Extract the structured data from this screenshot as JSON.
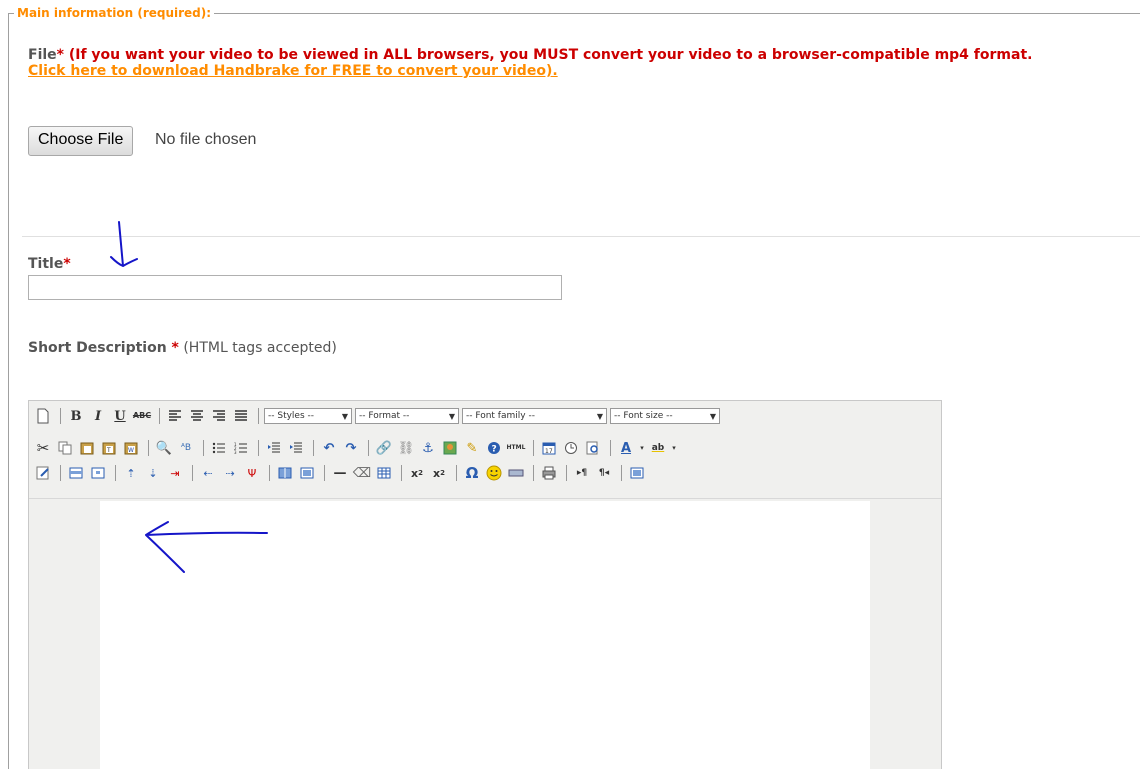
{
  "section": {
    "legend": "Main information (required):"
  },
  "file": {
    "label": "File",
    "required_mark": "*",
    "warning": " (If you want your video to be viewed in ALL browsers, you MUST convert your video to a browser-compatible mp4 format.",
    "link": "Click here to download Handbrake for FREE to convert your video).",
    "button_label": "Choose File",
    "status": "No file chosen"
  },
  "title_field": {
    "label": "Title",
    "required_mark": "*",
    "value": ""
  },
  "description": {
    "label": "Short Description",
    "required_mark": " *",
    "hint": " (HTML tags accepted)"
  },
  "editor": {
    "dropdowns": {
      "styles": "-- Styles --",
      "format": "-- Format --",
      "font_family": "-- Font family --",
      "font_size": "-- Font size --"
    },
    "html_button": "HTML"
  },
  "colors": {
    "accent": "#ff8c00",
    "required": "#cc0000",
    "annotation": "#1515c8"
  }
}
